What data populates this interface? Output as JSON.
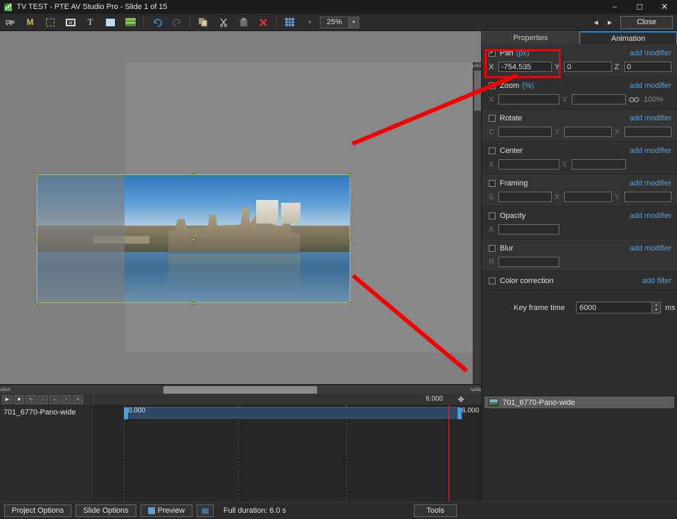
{
  "window": {
    "title": "TV TEST - PTE AV Studio Pro - Slide 1 of 15",
    "minimize": "–",
    "maximize": "☐",
    "close": "✕"
  },
  "toolbar": {
    "icons": [
      {
        "name": "projector-icon",
        "glyph": "📽"
      },
      {
        "name": "music-icon",
        "glyph": "M"
      },
      {
        "name": "crop-frame-icon",
        "glyph": "⬚"
      },
      {
        "name": "mask-icon",
        "glyph": "▣"
      },
      {
        "name": "text-icon",
        "glyph": "T"
      },
      {
        "name": "rectangle-icon",
        "glyph": "■"
      },
      {
        "name": "image-icon",
        "glyph": "▬"
      }
    ],
    "undo": "↶",
    "redo": "↷",
    "copy": "⧉",
    "cut": "✂",
    "paste": "⎙",
    "delete": "✕",
    "grid": "▦",
    "grid_dropdown": "▾",
    "zoom_value": "25%",
    "zoom_dropdown": "▾",
    "nav_prev": "◀",
    "nav_next": "▶",
    "close_label": "Close"
  },
  "panel": {
    "tabs": [
      {
        "label": "Properties",
        "active": false
      },
      {
        "label": "Animation",
        "active": true
      }
    ],
    "add_modifier_label": "add modifier",
    "add_filter_label": "add filter",
    "rows": [
      {
        "name": "pan",
        "label": "Pan",
        "unit": "(px)",
        "checked": true,
        "action": "add modifier",
        "fields": [
          {
            "label": "X",
            "value": "-754.535",
            "enabled": true
          },
          {
            "label": "Y",
            "value": "0",
            "enabled": true
          },
          {
            "label": "Z",
            "value": "0",
            "enabled": true
          }
        ]
      },
      {
        "name": "zoom",
        "label": "Zoom",
        "unit": "(%)",
        "checked": false,
        "action": "add modifier",
        "fields": [
          {
            "label": "X",
            "value": "",
            "enabled": false
          },
          {
            "label": "Y",
            "value": "",
            "enabled": false
          }
        ],
        "link_icon": "chain-link-icon",
        "percent": "100%"
      },
      {
        "name": "rotate",
        "label": "Rotate",
        "unit": "",
        "checked": false,
        "action": "add modifier",
        "fields": [
          {
            "label": "C",
            "value": "",
            "enabled": false
          },
          {
            "label": "Y",
            "value": "",
            "enabled": false
          },
          {
            "label": "X",
            "value": "",
            "enabled": false
          }
        ]
      },
      {
        "name": "center",
        "label": "Center",
        "unit": "",
        "checked": false,
        "action": "add modifier",
        "fields": [
          {
            "label": "X",
            "value": "",
            "enabled": false
          },
          {
            "label": "Y",
            "value": "",
            "enabled": false
          }
        ]
      },
      {
        "name": "framing",
        "label": "Framing",
        "unit": "",
        "checked": false,
        "action": "add modifier",
        "fields": [
          {
            "label": "S",
            "value": "",
            "enabled": false
          },
          {
            "label": "X",
            "value": "",
            "enabled": false
          },
          {
            "label": "Y",
            "value": "",
            "enabled": false
          }
        ]
      },
      {
        "name": "opacity",
        "label": "Opacity",
        "unit": "",
        "checked": false,
        "action": "add modifier",
        "fields": [
          {
            "label": "A",
            "value": "",
            "enabled": false
          }
        ]
      },
      {
        "name": "blur",
        "label": "Blur",
        "unit": "",
        "checked": false,
        "action": "add modifier",
        "fields": [
          {
            "label": "R",
            "value": "",
            "enabled": false
          }
        ]
      },
      {
        "name": "color-correction",
        "label": "Color correction",
        "unit": "",
        "checked": false,
        "action": "add filter",
        "fields": []
      }
    ],
    "key_frame_time": {
      "label": "Key frame time",
      "value": "6000",
      "unit": "ms",
      "up": "▲",
      "down": "▼"
    }
  },
  "objects": {
    "items": [
      {
        "name": "701_6770-Pano-wide",
        "icon": "image-thumb-icon"
      }
    ]
  },
  "timeline": {
    "buttons": [
      {
        "name": "play-button",
        "glyph": "▶"
      },
      {
        "name": "stop-button",
        "glyph": "■"
      },
      {
        "name": "waveform-button",
        "glyph": "∿"
      },
      {
        "name": "prev-keyframe-button",
        "glyph": "←"
      },
      {
        "name": "next-keyframe-button",
        "glyph": "→"
      },
      {
        "name": "zoom-out-button",
        "glyph": "−"
      },
      {
        "name": "zoom-in-button",
        "glyph": "+"
      }
    ],
    "end_time": "6.000",
    "move_icon": "✥",
    "track_name": "701_6770-Pano-wide",
    "keyframes": [
      {
        "time": "0.000",
        "position_pct": 0
      },
      {
        "time": "6.000",
        "position_pct": 100
      }
    ]
  },
  "bottom": {
    "project_options": "Project Options",
    "slide_options": "Slide Options",
    "preview": "Preview",
    "full_screen_icon": "fullscreen-icon",
    "status": "Full duration: 6.0 s",
    "tools": "Tools"
  },
  "colors": {
    "accent_blue": "#5b9fd6",
    "annotation_red": "#f40000",
    "selection_green": "#9ccc4a",
    "panel_bg": "#2e2e2e"
  }
}
